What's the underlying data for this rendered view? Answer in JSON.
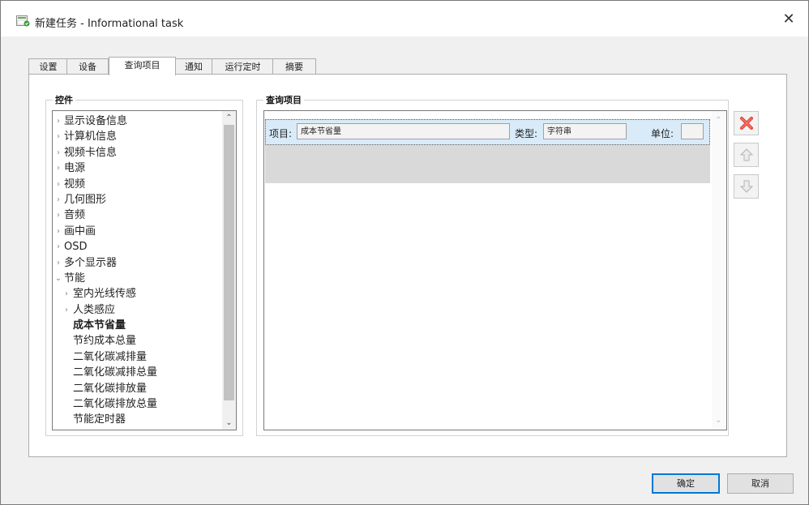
{
  "window": {
    "title": "新建任务 - Informational task",
    "close_glyph": "✕"
  },
  "tabs": [
    {
      "label": "设置"
    },
    {
      "label": "设备"
    },
    {
      "label": "查询项目"
    },
    {
      "label": "通知"
    },
    {
      "label": "运行定时"
    },
    {
      "label": "摘要"
    }
  ],
  "active_tab": "查询项目",
  "controls_group": {
    "label": "控件",
    "tree_items": [
      {
        "label": "显示设备信息",
        "arrow": "›"
      },
      {
        "label": "计算机信息",
        "arrow": "›"
      },
      {
        "label": "视频卡信息",
        "arrow": "›"
      },
      {
        "label": "电源",
        "arrow": "›"
      },
      {
        "label": "视频",
        "arrow": "›"
      },
      {
        "label": "几何图形",
        "arrow": "›"
      },
      {
        "label": "音频",
        "arrow": "›"
      },
      {
        "label": "画中画",
        "arrow": "›"
      },
      {
        "label": "OSD",
        "arrow": "›"
      },
      {
        "label": "多个显示器",
        "arrow": "›"
      },
      {
        "label": "节能",
        "arrow": "⌄"
      },
      {
        "label": "室内光线传感",
        "arrow": "›"
      },
      {
        "label": "人类感应",
        "arrow": "›"
      },
      {
        "label": "成本节省量",
        "arrow": ""
      },
      {
        "label": "节约成本总量",
        "arrow": ""
      },
      {
        "label": "二氧化碳减排量",
        "arrow": ""
      },
      {
        "label": "二氧化碳减排总量",
        "arrow": ""
      },
      {
        "label": "二氧化碳排放量",
        "arrow": ""
      },
      {
        "label": "二氧化碳排放总量",
        "arrow": ""
      },
      {
        "label": "节能定时器",
        "arrow": ""
      }
    ]
  },
  "query_group": {
    "label": "查询项目",
    "row": {
      "item_label": "项目:",
      "item_value": "成本节省量",
      "type_label": "类型:",
      "type_value": "字符串",
      "unit_label": "单位:",
      "unit_value": ""
    }
  },
  "side_buttons": [
    {
      "icon": "delete-icon"
    },
    {
      "icon": "move-up-icon"
    },
    {
      "icon": "move-down-icon"
    }
  ],
  "footer": {
    "ok_label": "确定",
    "cancel_label": "取消"
  },
  "colors": {
    "selection": "#d9ebf9",
    "delete": "#e0453a",
    "accent": "#0078d7"
  }
}
